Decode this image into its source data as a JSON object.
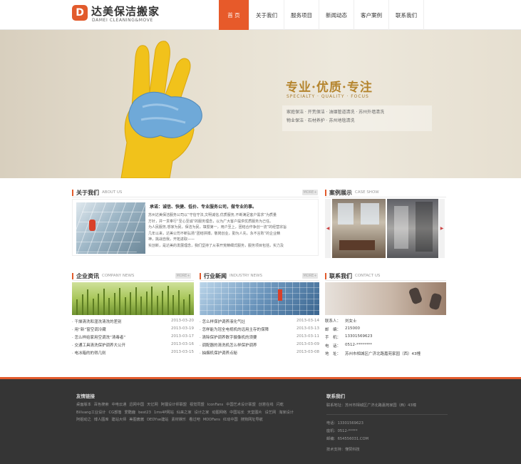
{
  "header": {
    "logo_mark": "D",
    "logo_cn": "达美保洁搬家",
    "logo_en": "DAMEI CLEANING&MOVE",
    "nav": [
      "首 页",
      "关于我们",
      "服务项目",
      "新闻动态",
      "客户案例",
      "联系我们"
    ]
  },
  "banner": {
    "slogan_cn": "专业·优质·专注",
    "slogan_en": "SPECIALTY · QUALITY · FOCUS",
    "services_line1": "家庭保洁 · 开荒保洁 · 油烟管道清洗 · 苏州外墙清洗",
    "services_line2": "物业保洁 · 石材养护 · 苏州地毯清洗"
  },
  "about": {
    "title_cn": "关于我们",
    "title_en": "ABOUT US",
    "more": "MORE+",
    "headline": "承诺：诚信、快捷、低价、专业服务公司，做专业的事。",
    "lines": [
      "苏州达美保洁服务公司以“守信守法,文明诚信,优质服务,不断满足客户需求”为质量",
      "方针，并一贯奉行“至心至诚”的服务理念，以为广大客户提供优质服务为己任。",
      "为人民服务,想家为民，保洁为民，填暨第一，用户至上，团结合作争创一流”的经营宗旨",
      "几年以来，达美公司不断弘扬“团结拼搏，敬岗创业，勤为人先，永不言败”的企业精",
      "神，挑战自我，开拓进取——",
      "实创新，是达美的发展理念，我们坚持了从事开荒精细式服务，服务项目包括，实力及"
    ]
  },
  "cases": {
    "title_cn": "案例展示",
    "title_en": "CASE SHOW",
    "prev": "◀",
    "next": "▶"
  },
  "company_news": {
    "title_cn": "企业资讯",
    "title_en": "COMPANY NEWS",
    "more": "MORE+",
    "items": [
      {
        "title": "· 干燥清洗和湿洗清洗的差别",
        "date": "2013-03-20"
      },
      {
        "title": "· 用“新”窗空调冷藏",
        "date": "2013-03-19"
      },
      {
        "title": "· 怎么样给家用空调洗“清毒者”",
        "date": "2013-03-17"
      },
      {
        "title": "· 交通工具清洗保护调养大公开",
        "date": "2013-03-16"
      },
      {
        "title": "· 电冰箱的的得几则",
        "date": "2013-03-15"
      }
    ]
  },
  "industry_news": {
    "title_cn": "行业新闻",
    "title_en": "INDUSTRY NEWS",
    "more": "MORE+",
    "items": [
      {
        "title": "· 怎么样保护调养液化气灶",
        "date": "2013-03-14"
      },
      {
        "title": "· 怎样能为冠全电视机的远用主存的保障",
        "date": "2013-03-13"
      },
      {
        "title": "· 清除保护调养数字摄像机的须要",
        "date": "2013-03-11"
      },
      {
        "title": "· 调配器的清洗机怎么样保护调养",
        "date": "2013-03-09"
      },
      {
        "title": "· 抽烟机保护调养点秘",
        "date": "2013-03-08"
      }
    ]
  },
  "contact": {
    "title_cn": "联系我们",
    "title_en": "CONTACT US",
    "rows": [
      {
        "k": "联系人：",
        "v": "刘女士"
      },
      {
        "k": "邮　编：",
        "v": "215000"
      },
      {
        "k": "手　机：",
        "v": "13301569623"
      },
      {
        "k": "电　话：",
        "v": "0512-********"
      },
      {
        "k": "地　址：",
        "v": "苏州市相城区广济北路嘉苑家园（西）43幢"
      }
    ]
  },
  "footer": {
    "links_title": "友情链接",
    "links": [
      "桌面版本",
      "百色搜索",
      "中电云通",
      "迅网中国",
      "天亿网",
      "阿狸设计师联盟",
      "视觉同盟",
      "IconFans",
      "中国艺术设计联盟",
      "创意在线",
      "闪乾",
      "Billvang工业设计",
      "CG部落",
      "爱酷鹿",
      "best23",
      "1ms4P网站",
      "仙来之家",
      "设计之家",
      "动图网络",
      "中国站长",
      "天堂图片",
      "设艺网",
      "淘家设计",
      "阿姐动之",
      "博人图库",
      "建站大师",
      "美图酱酱",
      "DEDYse建站",
      "素材娱乐",
      "看过吧",
      "MDDFans",
      "红动中国",
      "搜狗网址导航"
    ],
    "contact_title": "联系我们",
    "address": "联系地址：苏州市相城区广济北路嘉苑家园（西）43幢",
    "phone": "电话：13301569623",
    "tel": "座机：0512-*****",
    "email": "邮编：654556031.COM",
    "support": "技术支持：懂赞科技"
  },
  "colors": {
    "accent": "#e25b2c",
    "footer_bg": "#353535",
    "slogan": "#b5852e"
  }
}
